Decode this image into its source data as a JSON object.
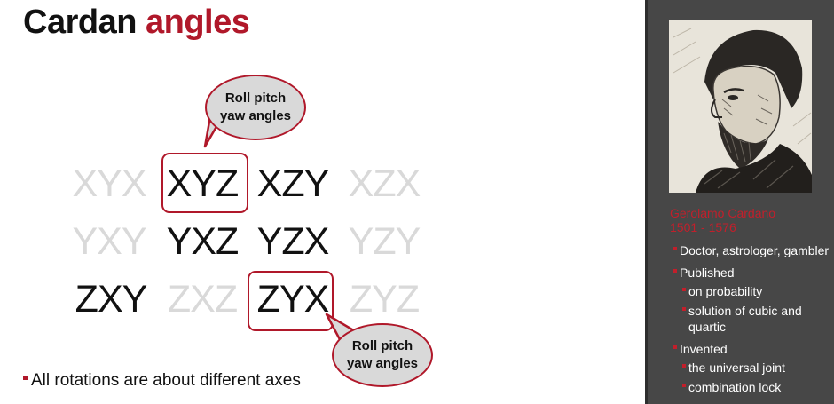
{
  "title": {
    "word1": "Cardan",
    "word2": "angles"
  },
  "grid": [
    [
      {
        "label": "XYX",
        "active": false
      },
      {
        "label": "XYZ",
        "active": true
      },
      {
        "label": "XZY",
        "active": true
      },
      {
        "label": "XZX",
        "active": false
      }
    ],
    [
      {
        "label": "YXY",
        "active": false
      },
      {
        "label": "YXZ",
        "active": true
      },
      {
        "label": "YZX",
        "active": true
      },
      {
        "label": "YZY",
        "active": false
      }
    ],
    [
      {
        "label": "ZXY",
        "active": true
      },
      {
        "label": "ZXZ",
        "active": false
      },
      {
        "label": "ZYX",
        "active": true
      },
      {
        "label": "ZYZ",
        "active": false
      }
    ]
  ],
  "callouts": [
    {
      "line1": "Roll pitch",
      "line2": "yaw angles"
    },
    {
      "line1": "Roll pitch",
      "line2": "yaw angles"
    }
  ],
  "bullet": "All rotations are about different axes",
  "sidebar": {
    "name": "Gerolamo Cardano",
    "dates": "1501 - 1576",
    "items": [
      {
        "text": "Doctor, astrologer, gambler",
        "level": 1
      },
      {
        "text": "Published",
        "level": 1
      },
      {
        "text": "on probability",
        "level": 2
      },
      {
        "text": "solution of cubic and",
        "level": 2
      },
      {
        "text": "quartic",
        "level": 2
      },
      {
        "text": "Invented",
        "level": 1
      },
      {
        "text": "the universal joint",
        "level": 2
      },
      {
        "text": "combination lock",
        "level": 2
      }
    ]
  },
  "colors": {
    "accent": "#b0182a",
    "dim": "#d9d9d9",
    "sidebar_bg": "#474747"
  },
  "portrait_icon": "cardano-portrait"
}
